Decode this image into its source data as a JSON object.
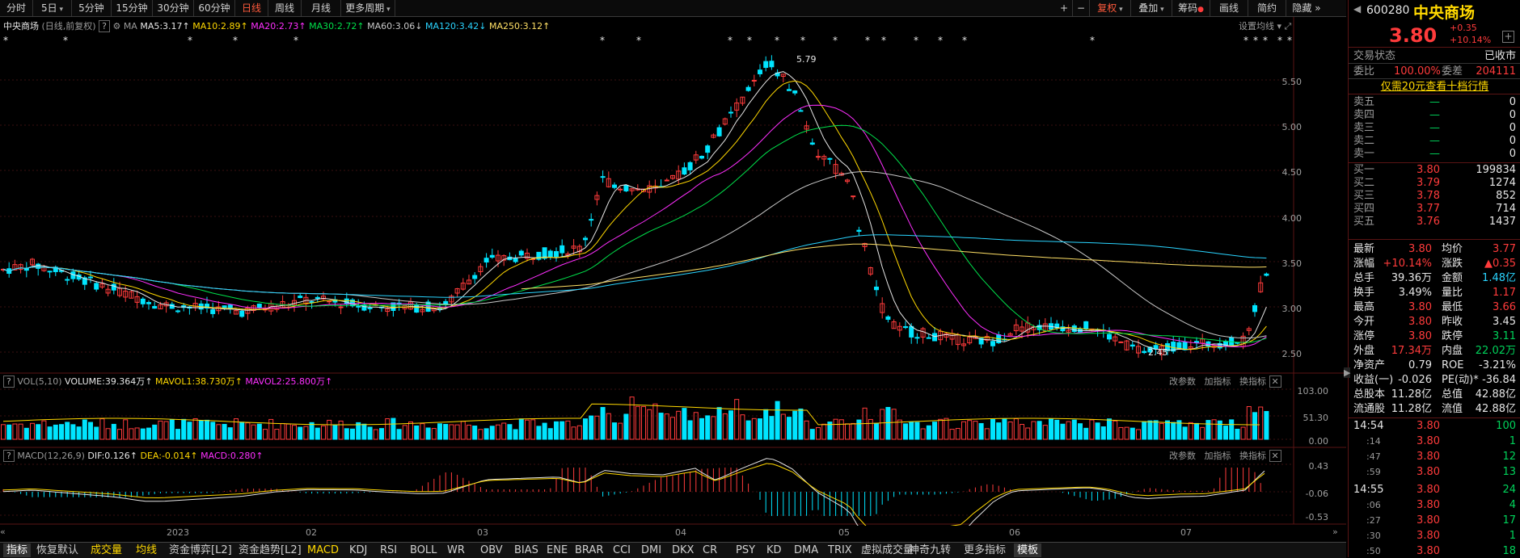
{
  "toolbar": {
    "periods": [
      "分时",
      "5日",
      "5分钟",
      "15分钟",
      "30分钟",
      "60分钟",
      "日线",
      "周线",
      "月线",
      "更多周期"
    ],
    "active_period": "日线",
    "right_buttons": [
      "复权",
      "叠加",
      "筹码",
      "画线",
      "简约",
      "隐藏"
    ],
    "plus": "+",
    "minus": "−"
  },
  "kline_header": {
    "name": "中央商场",
    "mode": "(日线,前复权)",
    "ma": "MA",
    "ma5": "MA5:3.17",
    "ma10": "MA10:2.89",
    "ma20": "MA20:2.73",
    "ma30": "MA30:2.72",
    "ma60": "MA60:3.06",
    "ma120": "MA120:3.42",
    "ma250": "MA250:3.12",
    "setting": "设置均线"
  },
  "price_axis": [
    "5.50",
    "5.00",
    "4.50",
    "4.00",
    "3.50",
    "3.00",
    "2.50"
  ],
  "annotations": {
    "high": "5.79",
    "low": "2.45"
  },
  "vol_header": {
    "name": "VOL(5,10)",
    "volume": "VOLUME:39.364万",
    "mavol1": "MAVOL1:38.730万",
    "mavol2": "MAVOL2:25.800万",
    "actions": [
      "改参数",
      "加指标",
      "换指标"
    ]
  },
  "vol_axis": [
    "103.00",
    "51.30",
    "0.00"
  ],
  "macd_header": {
    "name": "MACD(12,26,9)",
    "dif": "DIF:0.126",
    "dea": "DEA:-0.014",
    "macd": "MACD:0.280",
    "actions": [
      "改参数",
      "加指标",
      "换指标"
    ]
  },
  "macd_axis": [
    "0.43",
    "-0.06",
    "-0.53"
  ],
  "date_axis": [
    "2023",
    "02",
    "03",
    "04",
    "05",
    "06",
    "07"
  ],
  "bottom_tabs": [
    "指标",
    "恢复默认",
    "成交量",
    "均线",
    "资金博弈[L2]",
    "资金趋势[L2]",
    "MACD",
    "KDJ",
    "RSI",
    "BOLL",
    "WR",
    "OBV",
    "BIAS",
    "ENE",
    "BRAR",
    "CCI",
    "DMI",
    "DKX",
    "CR",
    "PSY",
    "KD",
    "DMA",
    "TRIX",
    "虚拟成交量",
    "神奇九转",
    "更多指标",
    "模板"
  ],
  "panel": {
    "code": "600280",
    "name": "中央商场",
    "price": "3.80",
    "change": "+0.35",
    "change_pct": "+10.14%",
    "trade_status_label": "交易状态",
    "trade_status": "已收市",
    "weibi_label": "委比",
    "weibi": "100.00%",
    "weicha_label": "委差",
    "weicha": "204111",
    "promo": "仅需20元查看十档行情",
    "sells": [
      {
        "label": "卖五",
        "price": "—",
        "vol": "0"
      },
      {
        "label": "卖四",
        "price": "—",
        "vol": "0"
      },
      {
        "label": "卖三",
        "price": "—",
        "vol": "0"
      },
      {
        "label": "卖二",
        "price": "—",
        "vol": "0"
      },
      {
        "label": "卖一",
        "price": "—",
        "vol": "0"
      }
    ],
    "buys": [
      {
        "label": "买一",
        "price": "3.80",
        "vol": "199834"
      },
      {
        "label": "买二",
        "price": "3.79",
        "vol": "1274"
      },
      {
        "label": "买三",
        "price": "3.78",
        "vol": "852"
      },
      {
        "label": "买四",
        "price": "3.77",
        "vol": "714"
      },
      {
        "label": "买五",
        "price": "3.76",
        "vol": "1437"
      }
    ],
    "stats": [
      [
        "最新",
        "3.80",
        "均价",
        "3.77"
      ],
      [
        "涨幅",
        "+10.14%",
        "涨跌",
        "▲0.35"
      ],
      [
        "总手",
        "39.36万",
        "金额",
        "1.48亿"
      ],
      [
        "换手",
        "3.49%",
        "量比",
        "1.17"
      ],
      [
        "最高",
        "3.80",
        "最低",
        "3.66"
      ],
      [
        "今开",
        "3.80",
        "昨收",
        "3.45"
      ],
      [
        "涨停",
        "3.80",
        "跌停",
        "3.11"
      ],
      [
        "外盘",
        "17.34万",
        "内盘",
        "22.02万"
      ],
      [
        "净资产",
        "0.79",
        "ROE",
        "-3.21%"
      ],
      [
        "收益(一)",
        "-0.026",
        "PE(动)*",
        "-36.84"
      ],
      [
        "总股本",
        "11.28亿",
        "总值",
        "42.88亿"
      ],
      [
        "流通股",
        "11.28亿",
        "流值",
        "42.88亿"
      ]
    ],
    "ticks": [
      [
        "14:54",
        "3.80",
        "100"
      ],
      [
        ":14",
        "3.80",
        "1"
      ],
      [
        ":47",
        "3.80",
        "12"
      ],
      [
        ":59",
        "3.80",
        "13"
      ],
      [
        "14:55",
        "3.80",
        "24"
      ],
      [
        ":06",
        "3.80",
        "4"
      ],
      [
        ":27",
        "3.80",
        "17"
      ],
      [
        ":30",
        "3.80",
        "1"
      ],
      [
        ":50",
        "3.80",
        "18"
      ]
    ]
  },
  "colors": {
    "up": "#ff3b3b",
    "down": "#00e5ff",
    "ma5": "#e6e6e6",
    "ma10": "#ffd800",
    "ma20": "#ff2fff",
    "ma30": "#00e14b",
    "ma60": "#c8c8c8",
    "ma120": "#2ad4ff",
    "ma250": "#ffe066"
  }
}
